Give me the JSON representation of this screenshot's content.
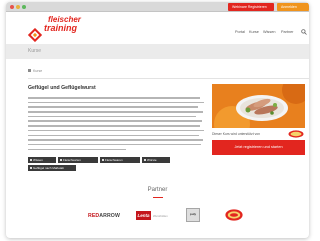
{
  "topbar": {
    "register_label": "Webinare Registrieren",
    "account_label": "Anmelden"
  },
  "brand": {
    "name_line1": "fleischer",
    "name_line2": "training",
    "primary_color": "#e2261f",
    "accent_color": "#f0941d"
  },
  "nav": {
    "items": [
      "Portal",
      "Kurse",
      "Wissen",
      "Partner"
    ],
    "search_icon": "search-icon"
  },
  "page": {
    "section_title": "Kurse",
    "breadcrumb_home_icon": "home-icon",
    "breadcrumb_label": "Kurse"
  },
  "article": {
    "title": "Geflügel und Geflügelwurst",
    "tags": [
      "Wissen",
      "Fleischsorten",
      "Fleischwaren",
      "Würste",
      "Geflügel nach Maßstab"
    ]
  },
  "sidebar": {
    "caption": "Dieser Kurs wird unterstützt von",
    "sponsor_icon": "sponsor-logo",
    "cta_label": "Jetzt registrieren und starten"
  },
  "partners": {
    "heading": "Partner",
    "logos": {
      "red_arrow_word1": "RED",
      "red_arrow_word2": "ARROW",
      "lenta": "Lenta",
      "lenta_sub": "Wursthüllen",
      "puly": "puly",
      "oval_icon": "oval-brand-logo"
    }
  }
}
